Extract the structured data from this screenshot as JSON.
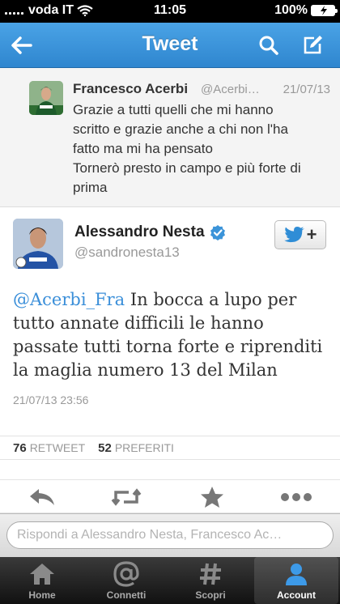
{
  "status_bar": {
    "carrier": "voda IT",
    "time": "11:05",
    "battery": "100%"
  },
  "nav": {
    "title": "Tweet",
    "icons": [
      "back-arrow-icon",
      "search-icon",
      "compose-icon"
    ]
  },
  "original_tweet": {
    "name": "Francesco Acerbi",
    "handle": "@Acerbi…",
    "date": "21/07/13",
    "lines": [
      "Grazie a tutti quelli che mi hanno",
      "scritto e grazie anche a chi non l'ha",
      "fatto ma mi ha pensato",
      "Tornerò presto in campo e più forte di",
      "prima"
    ]
  },
  "tweet": {
    "name": "Alessandro Nesta",
    "handle": "@sandronesta13",
    "mention": "@Acerbi_Fra",
    "text": " In bocca a lupo per tutto annate difficili le hanno passate tutti torna forte e riprenditi la maglia numero 13 del Milan",
    "timestamp": "21/07/13 23:56",
    "retweets": "76",
    "retweet_label": "RETWEET",
    "favorites": "52",
    "favorite_label": "PREFERITI",
    "verified_color": "#3b94d9"
  },
  "actions": [
    "reply-icon",
    "retweet-icon",
    "favorite-star-icon",
    "more-icon"
  ],
  "reply": {
    "placeholder": "Rispondi a Alessandro Nesta, Francesco Ac…"
  },
  "tabs": [
    {
      "label": "Home",
      "icon": "home-icon"
    },
    {
      "label": "Connetti",
      "icon": "at-icon"
    },
    {
      "label": "Scopri",
      "icon": "hash-icon"
    },
    {
      "label": "Account",
      "icon": "person-icon",
      "active": true
    }
  ],
  "colors": {
    "accent": "#2f86cf",
    "link": "#3b8fd9"
  }
}
